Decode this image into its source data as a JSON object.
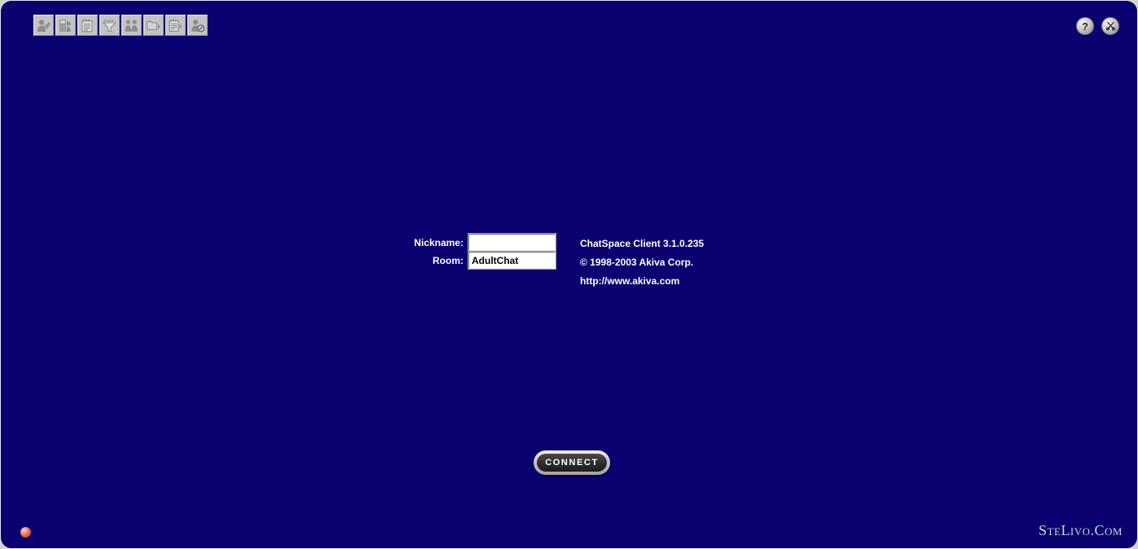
{
  "app": {
    "title": "ChatSpace Client",
    "background_color": "#0a0070",
    "frame_border_color": "#e8e8e8"
  },
  "toolbar": {
    "buttons": [
      {
        "name": "user-profile-icon",
        "label": "User Profile"
      },
      {
        "name": "directory-icon",
        "label": "Directory"
      },
      {
        "name": "notes-icon",
        "label": "Notes"
      },
      {
        "name": "filter-icon",
        "label": "Filter"
      },
      {
        "name": "group-users-icon",
        "label": "Users"
      },
      {
        "name": "folder-arrow-icon",
        "label": "Rooms"
      },
      {
        "name": "list-arrow-icon",
        "label": "Message List"
      },
      {
        "name": "ignore-user-icon",
        "label": "Ignore List"
      }
    ]
  },
  "window_buttons": {
    "help_glyph": "?",
    "help_label": "Help",
    "tools_glyph": "✂",
    "tools_label": "Tools"
  },
  "login": {
    "nickname_label": "Nickname:",
    "nickname_value": "",
    "nickname_placeholder": "",
    "room_label": "Room:",
    "room_value": "AdultChat",
    "room_placeholder": ""
  },
  "about": {
    "line1": "ChatSpace Client 3.1.0.235",
    "line2": "© 1998-2003 Akiva Corp.",
    "line3": "http://www.akiva.com"
  },
  "connect": {
    "label": "CONNECT"
  },
  "status": {
    "indicator_color": "#cc4a34"
  },
  "watermark": {
    "text": "SteLivo.Com",
    "color": "#c9d6f5"
  }
}
